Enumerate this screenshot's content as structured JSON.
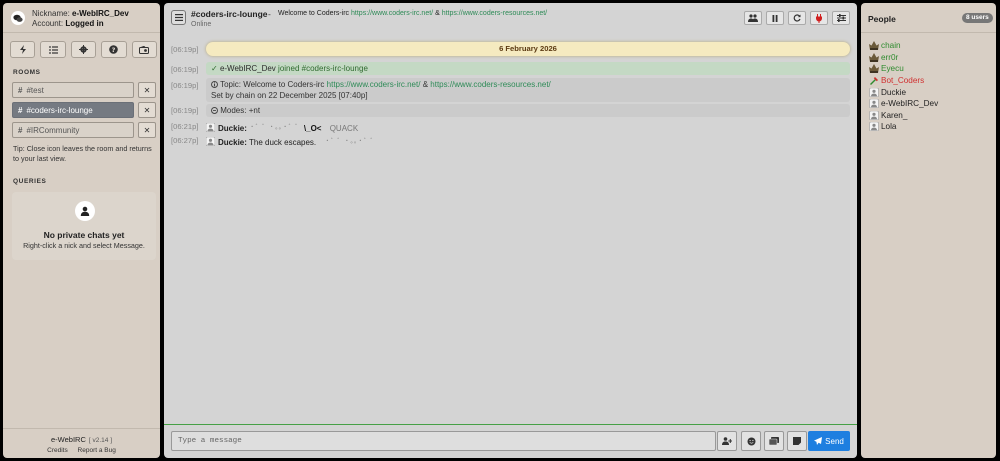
{
  "sidebar": {
    "nickname_label": "Nickname:",
    "nickname": "e-WebIRC_Dev",
    "account_label": "Account:",
    "account_status": "Logged in",
    "rooms_title": "ROOMS",
    "rooms": [
      {
        "name": "#test"
      },
      {
        "name": "#coders-irc-lounge"
      },
      {
        "name": "#IRCommunity"
      }
    ],
    "tip": "Tip: Close icon leaves the room and returns to your last view.",
    "queries_title": "QUERIES",
    "empty_title": "No private chats yet",
    "empty_sub": "Right-click a nick and select Message.",
    "footer_title": "e-WebIRC",
    "footer_version": "[ v2.14 ]",
    "footer_credits": "Credits",
    "footer_report": "Report a Bug",
    "close_glyph": "✕"
  },
  "channel": {
    "name": "#coders-irc-lounge",
    "dash": "-",
    "topic_prefix": "Welcome to Coders-irc",
    "topic_link1": "https://www.coders-irc.net/",
    "topic_amp": "&",
    "topic_link2": "https://www.coders-resources.net/",
    "status": "Online"
  },
  "messages": {
    "date": "6 February 2026",
    "join": {
      "ts": "[06:19p]",
      "check": "✓",
      "nick": "e-WebIRC_Dev",
      "text": "joined",
      "chan": "#coders-irc-lounge"
    },
    "topic": {
      "ts": "[06:19p]",
      "label": "Topic: Welcome to Coders-irc",
      "link1": "https://www.coders-irc.net/",
      "amp": "&",
      "link2": "https://www.coders-resources.net/",
      "setby": "Set by chain on 22 December 2025 [07:40p]"
    },
    "modes": {
      "ts": "[06:19p]",
      "text": "Modes: +nt"
    },
    "duck1": {
      "ts": "[06:21p]",
      "nick": "Duckie:",
      "trail": "・゜゜・。。・゜゜",
      "head": "\\_O<",
      "quack": "QUACK"
    },
    "duck2": {
      "ts": "[06:27p]",
      "nick": "Duckie:",
      "text": "The duck escapes.",
      "trail": "・゜゜・。。・゜゜"
    }
  },
  "input": {
    "placeholder": "Type a message",
    "send_label": "Send"
  },
  "people": {
    "title": "People",
    "count": "8 users",
    "users": [
      {
        "nick": "chain",
        "color": "#2e8b2e",
        "role": "owner"
      },
      {
        "nick": "err0r",
        "color": "#2e8b2e",
        "role": "owner"
      },
      {
        "nick": "Eyecu",
        "color": "#2e8b2e",
        "role": "owner"
      },
      {
        "nick": "Bot_Coders",
        "color": "#d03030",
        "role": "bot"
      },
      {
        "nick": "Duckie",
        "color": "#222222",
        "role": "user"
      },
      {
        "nick": "e-WebIRC_Dev",
        "color": "#222222",
        "role": "user"
      },
      {
        "nick": "Karen_",
        "color": "#222222",
        "role": "user"
      },
      {
        "nick": "Lola",
        "color": "#222222",
        "role": "user"
      }
    ]
  },
  "colors": {
    "accent": "#1e7fe0",
    "online_green": "#46a046",
    "date_bg": "#f5eac0"
  }
}
